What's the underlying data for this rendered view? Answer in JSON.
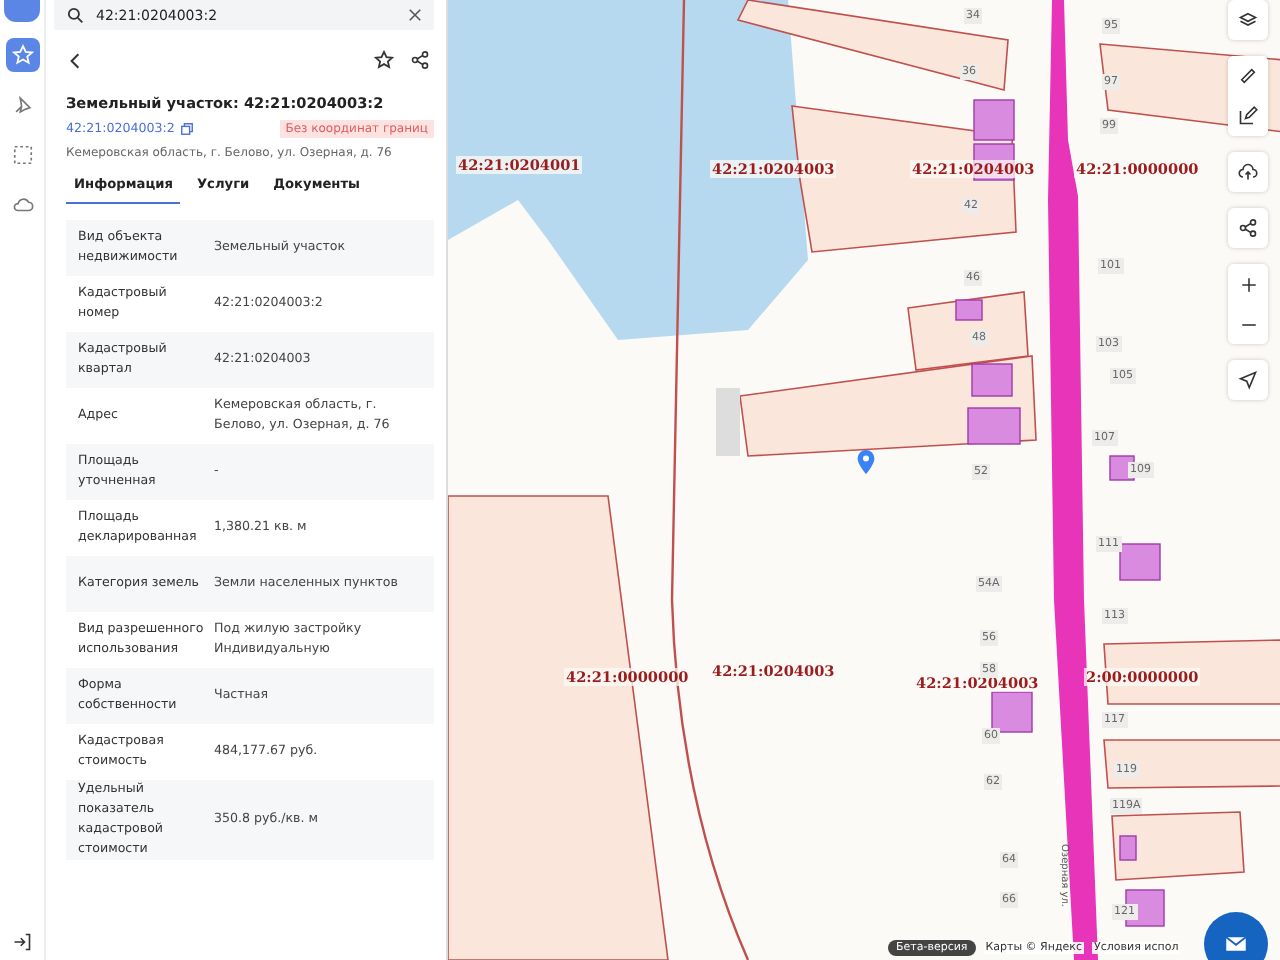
{
  "rail": {
    "items": [
      {
        "selected": true
      },
      {
        "selected": false
      },
      {
        "selected": false
      },
      {
        "selected": false
      }
    ]
  },
  "search": {
    "value": "42:21:0204003:2"
  },
  "card": {
    "title": "Земельный участок: 42:21:0204003:2",
    "number": "42:21:0204003:2",
    "badge": "Без координат границ",
    "address": "Кемеровская область, г. Белово, ул. Озерная, д. 76",
    "tabs": [
      {
        "label": "Информация",
        "selected": true
      },
      {
        "label": "Услуги",
        "selected": false
      },
      {
        "label": "Документы",
        "selected": false
      }
    ],
    "rows": [
      {
        "label": "Вид объекта недвижимости",
        "value": "Земельный участок"
      },
      {
        "label": "Кадастровый номер",
        "value": "42:21:0204003:2"
      },
      {
        "label": "Кадастровый квартал",
        "value": "42:21:0204003"
      },
      {
        "label": "Адрес",
        "value": "Кемеровская область, г. Белово, ул. Озерная, д. 76"
      },
      {
        "label": "Площадь уточненная",
        "value": "-"
      },
      {
        "label": "Площадь декларированная",
        "value": "1,380.21 кв. м"
      },
      {
        "label": "Категория земель",
        "value": "Земли населенных пунктов"
      },
      {
        "label": "Вид разрешенного использования",
        "value": "Под жилую застройку Индивидуальную"
      },
      {
        "label": "Форма собственности",
        "value": "Частная"
      },
      {
        "label": "Кадастровая стоимость",
        "value": "484,177.67 руб."
      },
      {
        "label": "Удельный показатель кадастровой стоимости",
        "value": "350.8 руб./кв. м"
      }
    ]
  },
  "map": {
    "quarters": [
      "42:21:0204001",
      "42:21:0204003",
      "42:21:0204003",
      "42:21:0000000",
      "42:21:0000000",
      "42:21:0204003",
      "42:21:0204003",
      "2:00:0000000"
    ],
    "houses": [
      "34",
      "36",
      "42",
      "46",
      "48",
      "52",
      "54А",
      "56",
      "58",
      "60",
      "62",
      "64",
      "66",
      "95",
      "97",
      "99",
      "101",
      "103",
      "105",
      "107",
      "109",
      "111",
      "113",
      "117",
      "119",
      "119А",
      "121"
    ],
    "street": "Озерная ул.",
    "beta": "Бета-версия",
    "copyright": "Карты © Яндекс",
    "terms": "Условия испол"
  }
}
